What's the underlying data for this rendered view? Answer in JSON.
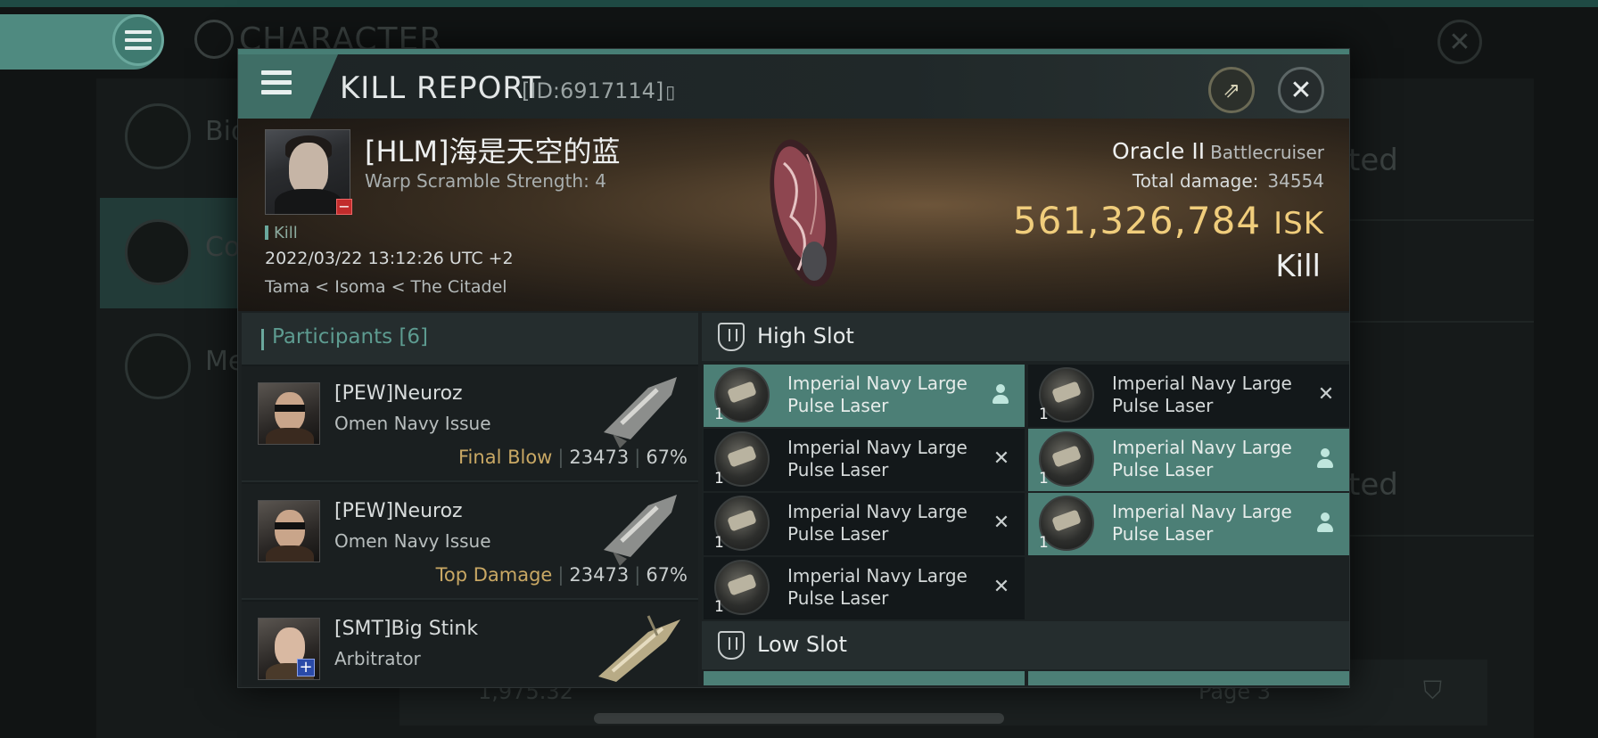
{
  "background": {
    "title": "CHARACTER",
    "side_items": [
      {
        "label": "Bio"
      },
      {
        "label": "Co"
      },
      {
        "label": "Me"
      }
    ],
    "right_texts": [
      "ted",
      "ted"
    ],
    "footer": {
      "value": "1,975.32",
      "page_label": "Page 3"
    }
  },
  "modal": {
    "title": "KILL REPORT",
    "id_label": "[ID:6917114]",
    "victim": {
      "name": "[HLM]海是天空的蓝",
      "warp": "Warp Scramble Strength: 4",
      "tag": "Kill",
      "datetime": "2022/03/22 13:12:26 UTC +2",
      "location": "Tama < Isoma < The Citadel"
    },
    "ship": {
      "name": "Oracle II",
      "class": "Battlecruiser",
      "total_damage_label": "Total damage:",
      "total_damage": "34554",
      "isk_value": "561,326,784",
      "isk_unit": "ISK",
      "result": "Kill"
    },
    "participants": {
      "label": "Participants",
      "count": "[6]",
      "rows": [
        {
          "name": "[PEW]Neuroz",
          "ship": "Omen Navy Issue",
          "tag": "Final Blow",
          "damage": "23473",
          "percent": "67%"
        },
        {
          "name": "[PEW]Neuroz",
          "ship": "Omen Navy Issue",
          "tag": "Top Damage",
          "damage": "23473",
          "percent": "67%"
        },
        {
          "name": "[SMT]Big Stink",
          "ship": "Arbitrator",
          "tag": "",
          "damage": "",
          "percent": ""
        }
      ]
    },
    "high_slot": {
      "label": "High Slot",
      "modules": [
        {
          "name": "Imperial Navy Large Pulse Laser",
          "qty": "1",
          "status": "dropped"
        },
        {
          "name": "Imperial Navy Large Pulse Laser",
          "qty": "1",
          "status": "destroyed"
        },
        {
          "name": "Imperial Navy Large Pulse Laser",
          "qty": "1",
          "status": "destroyed"
        },
        {
          "name": "Imperial Navy Large Pulse Laser",
          "qty": "1",
          "status": "dropped"
        },
        {
          "name": "Imperial Navy Large Pulse Laser",
          "qty": "1",
          "status": "destroyed"
        },
        {
          "name": "Imperial Navy Large Pulse Laser",
          "qty": "1",
          "status": "dropped"
        },
        {
          "name": "Imperial Navy Large Pulse Laser",
          "qty": "1",
          "status": "destroyed"
        }
      ]
    },
    "low_slot": {
      "label": "Low Slot"
    },
    "colors": {
      "accent": "#4c7f76",
      "isk": "#f0cd7c",
      "tag_gold": "#c9a864"
    },
    "icons": {
      "menu": "hamburger-icon",
      "external": "external-link-icon",
      "close": "close-icon",
      "copy": "copy-icon"
    }
  }
}
